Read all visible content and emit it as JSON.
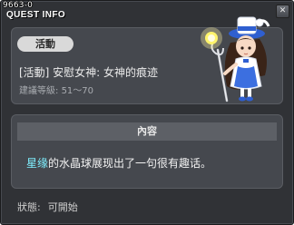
{
  "window": {
    "id": "9663-0",
    "title": "QUEST INFO",
    "close_symbol": "✕"
  },
  "quest": {
    "category": "活動",
    "name": "[活動] 安慰女神: 女神的痕迹",
    "level_label": "建議等級:",
    "level_range": "51～70"
  },
  "content": {
    "header": "內容",
    "highlight": "星缘",
    "text": "的水晶球展现出了一句很有趣话。"
  },
  "status": {
    "label": "狀態:",
    "value": "可開始"
  },
  "colors": {
    "background": "#303236",
    "panel": "#45484e",
    "highlight_text": "#7ff0ff"
  },
  "icons": {
    "npc": "goddess-npc-portrait",
    "close": "close-icon"
  }
}
